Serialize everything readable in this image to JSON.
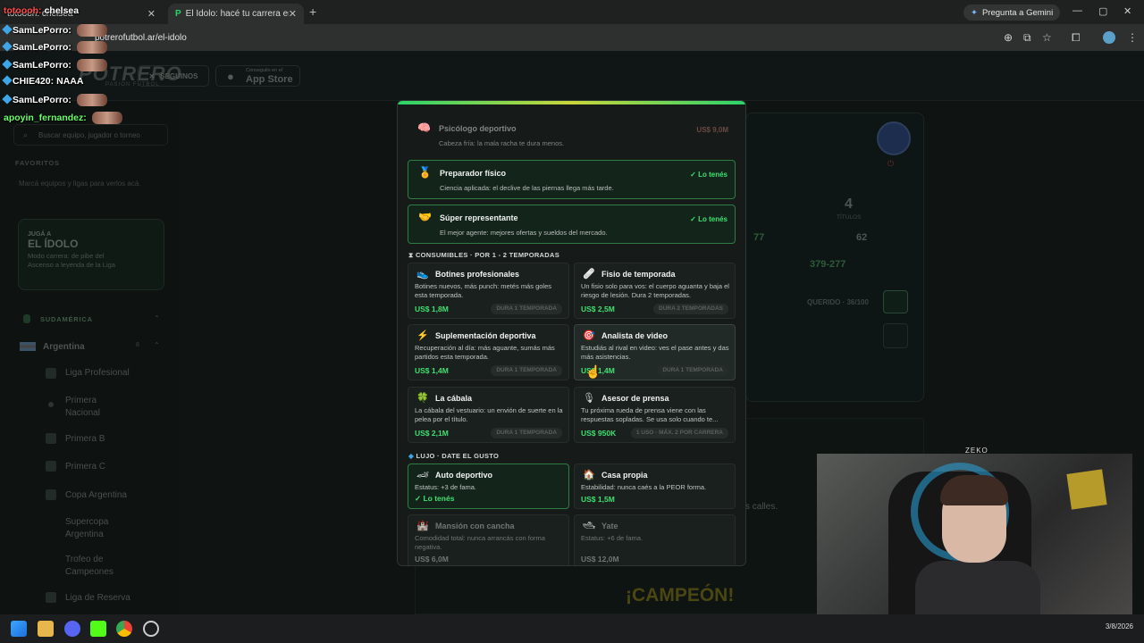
{
  "browser": {
    "tabs": [
      {
        "title": "totoooh: chelsea"
      },
      {
        "title": "El Ídolo: hacé tu carrera en la L..."
      }
    ],
    "gemini_label": "Pregunta a Gemini",
    "url": "potrerofutbol.ar/el-idolo"
  },
  "chat": [
    {
      "user": "totoooh:",
      "msg": "chelsea",
      "color": "#ff4b4b",
      "emote": false
    },
    {
      "user": "SamLePorro:",
      "msg": "",
      "color": "#ffffff",
      "emote": true
    },
    {
      "user": "SamLePorro:",
      "msg": "",
      "color": "#ffffff",
      "emote": true
    },
    {
      "user": "SamLePorro:",
      "msg": "",
      "color": "#ffffff",
      "emote": true
    },
    {
      "user": "CHIE420:",
      "msg": "NAAA",
      "color": "#ffffff",
      "emote": false
    },
    {
      "user": "SamLePorro:",
      "msg": "",
      "color": "#ffffff",
      "emote": true
    },
    {
      "user": "apoyin_fernandez:",
      "msg": "",
      "color": "#6bff6b",
      "emote": true
    }
  ],
  "site": {
    "logo": "POTRERO",
    "logo_sub": "PASIÓN FÚTBOL",
    "follow_label": "SEGUINOS",
    "app_small": "Conseguilo en el",
    "app_big": "App Store",
    "search_placeholder": "Buscar equipo, jugador o torneo",
    "favorites_title": "FAVORITOS",
    "favorites_hint": "Marcá equipos y ligas para verlos acá.",
    "promo": {
      "kicker": "JUGÁ A",
      "title": "EL ÍDOLO",
      "text": "Modo carrera: de pibe del Ascenso a leyenda de la Liga"
    },
    "region": "SUDAMÉRICA",
    "country": "Argentina",
    "country_count": "8",
    "nav": [
      "Liga Profesional",
      "Primera Nacional",
      "Primera B",
      "Primera C",
      "Copa Argentina",
      "Supercopa Argentina",
      "Trofeo de Campeones",
      "Liga de Reserva"
    ],
    "bg_stats": {
      "titles_value": "4",
      "titles_label": "TÍTULOS",
      "stat_a": "77",
      "stat_b": "62",
      "score": "379-277",
      "querido": "QUERIDO · 36/100"
    },
    "bg_text": "s calles.",
    "champion": "¡CAMPEÓN!"
  },
  "modal": {
    "top_rows": [
      {
        "icon": "brain-icon",
        "glyph": "🧠",
        "title": "Psicólogo deportivo",
        "desc": "Cabeza fría: la mala racha te dura menos.",
        "price": "US$ 9,0M",
        "owned": false
      },
      {
        "icon": "trophy-icon",
        "glyph": "🏅",
        "title": "Preparador físico",
        "desc": "Ciencia aplicada: el declive de las piernas llega más tarde.",
        "price": "✓ Lo tenés",
        "owned": true
      },
      {
        "icon": "handshake-icon",
        "glyph": "🤝",
        "title": "Súper representante",
        "desc": "El mejor agente: mejores ofertas y sueldos del mercado.",
        "price": "✓ Lo tenés",
        "owned": true
      }
    ],
    "consumables_title": "CONSUMIBLES · POR 1 - 2 TEMPORADAS",
    "consumables": [
      {
        "icon": "boots-icon",
        "glyph": "👟",
        "title": "Botines profesionales",
        "desc": "Botines nuevos, más punch: metés más goles esta temporada.",
        "price": "US$ 1,8M",
        "duration": "DURA 1 TEMPORADA"
      },
      {
        "icon": "bandage-icon",
        "glyph": "🩹",
        "title": "Fisio de temporada",
        "desc": "Un fisio solo para vos: el cuerpo aguanta y baja el riesgo de lesión. Dura 2 temporadas.",
        "price": "US$ 2,5M",
        "duration": "DURA 2 TEMPORADAS"
      },
      {
        "icon": "bolt-icon",
        "glyph": "⚡",
        "title": "Suplementación deportiva",
        "desc": "Recuperación al día: más aguante, sumás más partidos esta temporada.",
        "price": "US$ 1,4M",
        "duration": "DURA 1 TEMPORADA"
      },
      {
        "icon": "target-icon",
        "glyph": "🎯",
        "title": "Analista de video",
        "desc": "Estudiás al rival en video: ves el pase antes y das más asistencias.",
        "price": "US$ 1,4M",
        "duration": "DURA 1 TEMPORADA"
      },
      {
        "icon": "clover-icon",
        "glyph": "🍀",
        "title": "La cábala",
        "desc": "La cábala del vestuario: un envión de suerte en la pelea por el título.",
        "price": "US$ 2,1M",
        "duration": "DURA 1 TEMPORADA"
      },
      {
        "icon": "microphone-icon",
        "glyph": "🎙",
        "title": "Asesor de prensa",
        "desc": "Tu próxima rueda de prensa viene con las respuestas sopladas. Se usa solo cuando te...",
        "price": "US$ 950K",
        "duration": "1 USO · MÁX. 2 POR CARRERA"
      }
    ],
    "luxury_title": "LUJO · DATE EL GUSTO",
    "luxury": [
      {
        "icon": "car-icon",
        "glyph": "🏎",
        "title": "Auto deportivo",
        "desc": "Estatus: +3 de fama.",
        "price": "✓ Lo tenés",
        "owned": true
      },
      {
        "icon": "house-icon",
        "glyph": "🏠",
        "title": "Casa propia",
        "desc": "Estabilidad: nunca caés a la PEOR forma.",
        "price": "US$ 1,5M",
        "owned": false
      },
      {
        "icon": "castle-icon",
        "glyph": "🏰",
        "title": "Mansión con cancha",
        "desc": "Comodidad total: nunca arrancás con forma negativa.",
        "price": "US$ 6,0M",
        "owned": false
      },
      {
        "icon": "yacht-icon",
        "glyph": "🛥",
        "title": "Yate",
        "desc": "Estatus: +6 de fama.",
        "price": "US$ 12,0M",
        "owned": false
      }
    ]
  },
  "webcam_label": "ZEKO",
  "clock": {
    "date": "3/8/2026"
  },
  "colors": {
    "accent": "#3fe070",
    "owned_border": "#2f7d43",
    "modal_bg": "#161b19"
  }
}
